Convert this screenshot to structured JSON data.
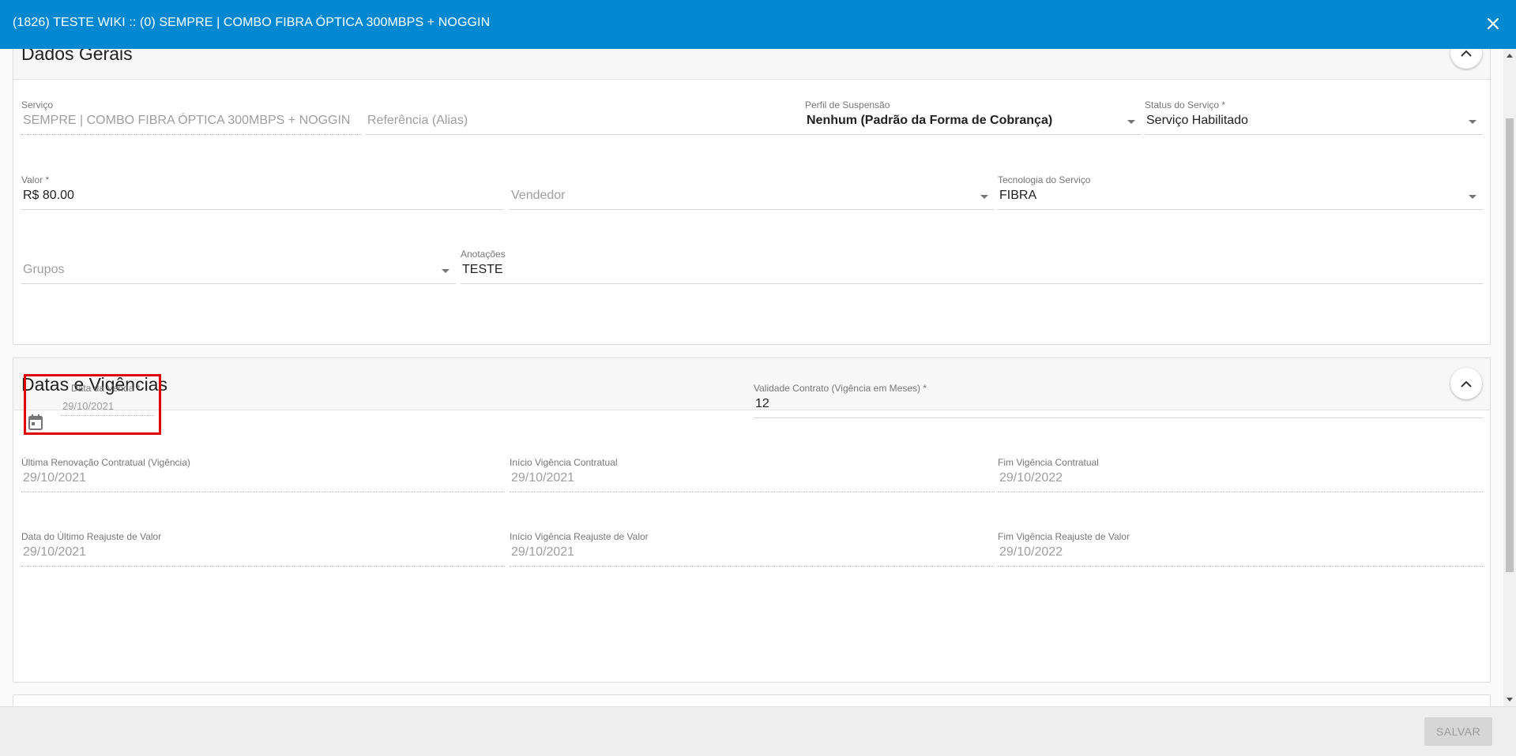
{
  "window": {
    "title": "(1826) TESTE WIKI :: (0) SEMPRE | COMBO FIBRA ÓPTICA 300MBPS + NOGGIN",
    "close_icon": "close-icon",
    "header_color": "#0288d1"
  },
  "dados_gerais": {
    "title": "Dados Gerais",
    "servico": {
      "label": "Serviço",
      "value": "SEMPRE | COMBO FIBRA ÓPTICA 300MBPS + NOGGIN"
    },
    "referencia": {
      "placeholder": "Referência (Alias)"
    },
    "perfil_suspensao": {
      "label": "Perfil de Suspensão",
      "value": "Nenhum (Padrão da Forma de Cobrança)"
    },
    "status_servico": {
      "label": "Status do Serviço *",
      "value": "Serviço Habilitado"
    },
    "valor": {
      "label": "Valor *",
      "value": "R$ 80.00"
    },
    "vendedor": {
      "placeholder": "Vendedor"
    },
    "tecnologia": {
      "label": "Tecnologia do Serviço",
      "value": "FIBRA"
    },
    "grupos": {
      "placeholder": "Grupos"
    },
    "anotacoes": {
      "label": "Anotações",
      "value": "TESTE"
    }
  },
  "datas_vigencias": {
    "title": "Datas e Vigências",
    "collapse_icon": "chevron-up-icon",
    "data_venda": {
      "label": "Data da Venda *",
      "value": "29/10/2021",
      "icon": "calendar-icon"
    },
    "validade_contrato": {
      "label": "Validade Contrato (Vigência em Meses) *",
      "value": "12"
    },
    "ultima_renovacao": {
      "label": "Última Renovação Contratual (Vigência)",
      "value": "29/10/2021"
    },
    "inicio_vigencia": {
      "label": "Início Vigência Contratual",
      "value": "29/10/2021"
    },
    "fim_vigencia": {
      "label": "Fim Vigência Contratual",
      "value": "29/10/2022"
    },
    "data_ultimo_reajuste": {
      "label": "Data do Último Reajuste de Valor",
      "value": "29/10/2021"
    },
    "inicio_reajuste": {
      "label": "Início Vigência Reajuste de Valor",
      "value": "29/10/2021"
    },
    "fim_reajuste": {
      "label": "Fim Vigência Reajuste de Valor",
      "value": "29/10/2022"
    }
  },
  "footer": {
    "save_label": "SALVAR"
  }
}
